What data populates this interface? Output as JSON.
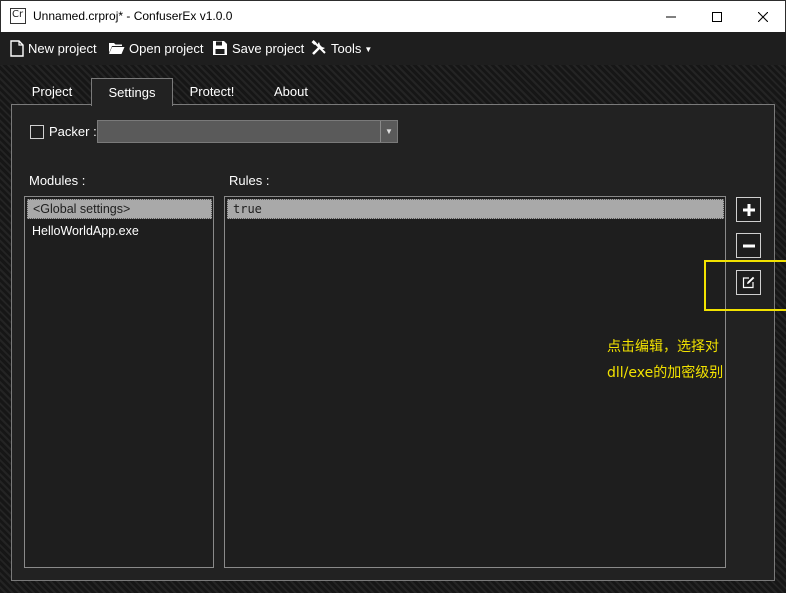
{
  "window": {
    "title": "Unnamed.crproj* - ConfuserEx v1.0.0",
    "icon_text": "Cr",
    "controls": [
      "minimize-icon",
      "maximize-icon",
      "close-icon"
    ]
  },
  "toolbar": {
    "new_label": "New project",
    "open_label": "Open project",
    "save_label": "Save project",
    "tools_label": "Tools"
  },
  "tabs": [
    {
      "label": "Project",
      "active": false
    },
    {
      "label": "Settings",
      "active": true
    },
    {
      "label": "Protect!",
      "active": false
    },
    {
      "label": "About",
      "active": false
    }
  ],
  "settings": {
    "packer_label": "Packer :",
    "packer_checked": false,
    "packer_value": "",
    "modules_label": "Modules :",
    "rules_label": "Rules :",
    "modules": [
      "<Global settings>",
      "HelloWorldApp.exe"
    ],
    "selected_module": 0,
    "rules": [
      "true"
    ],
    "selected_rule": 0
  },
  "side_buttons": [
    "plus-icon",
    "minus-icon",
    "edit-icon"
  ],
  "annotation": {
    "line1": "点击编辑，选择对",
    "line2": "dll/exe的加密级别",
    "color": "#f2e200"
  }
}
